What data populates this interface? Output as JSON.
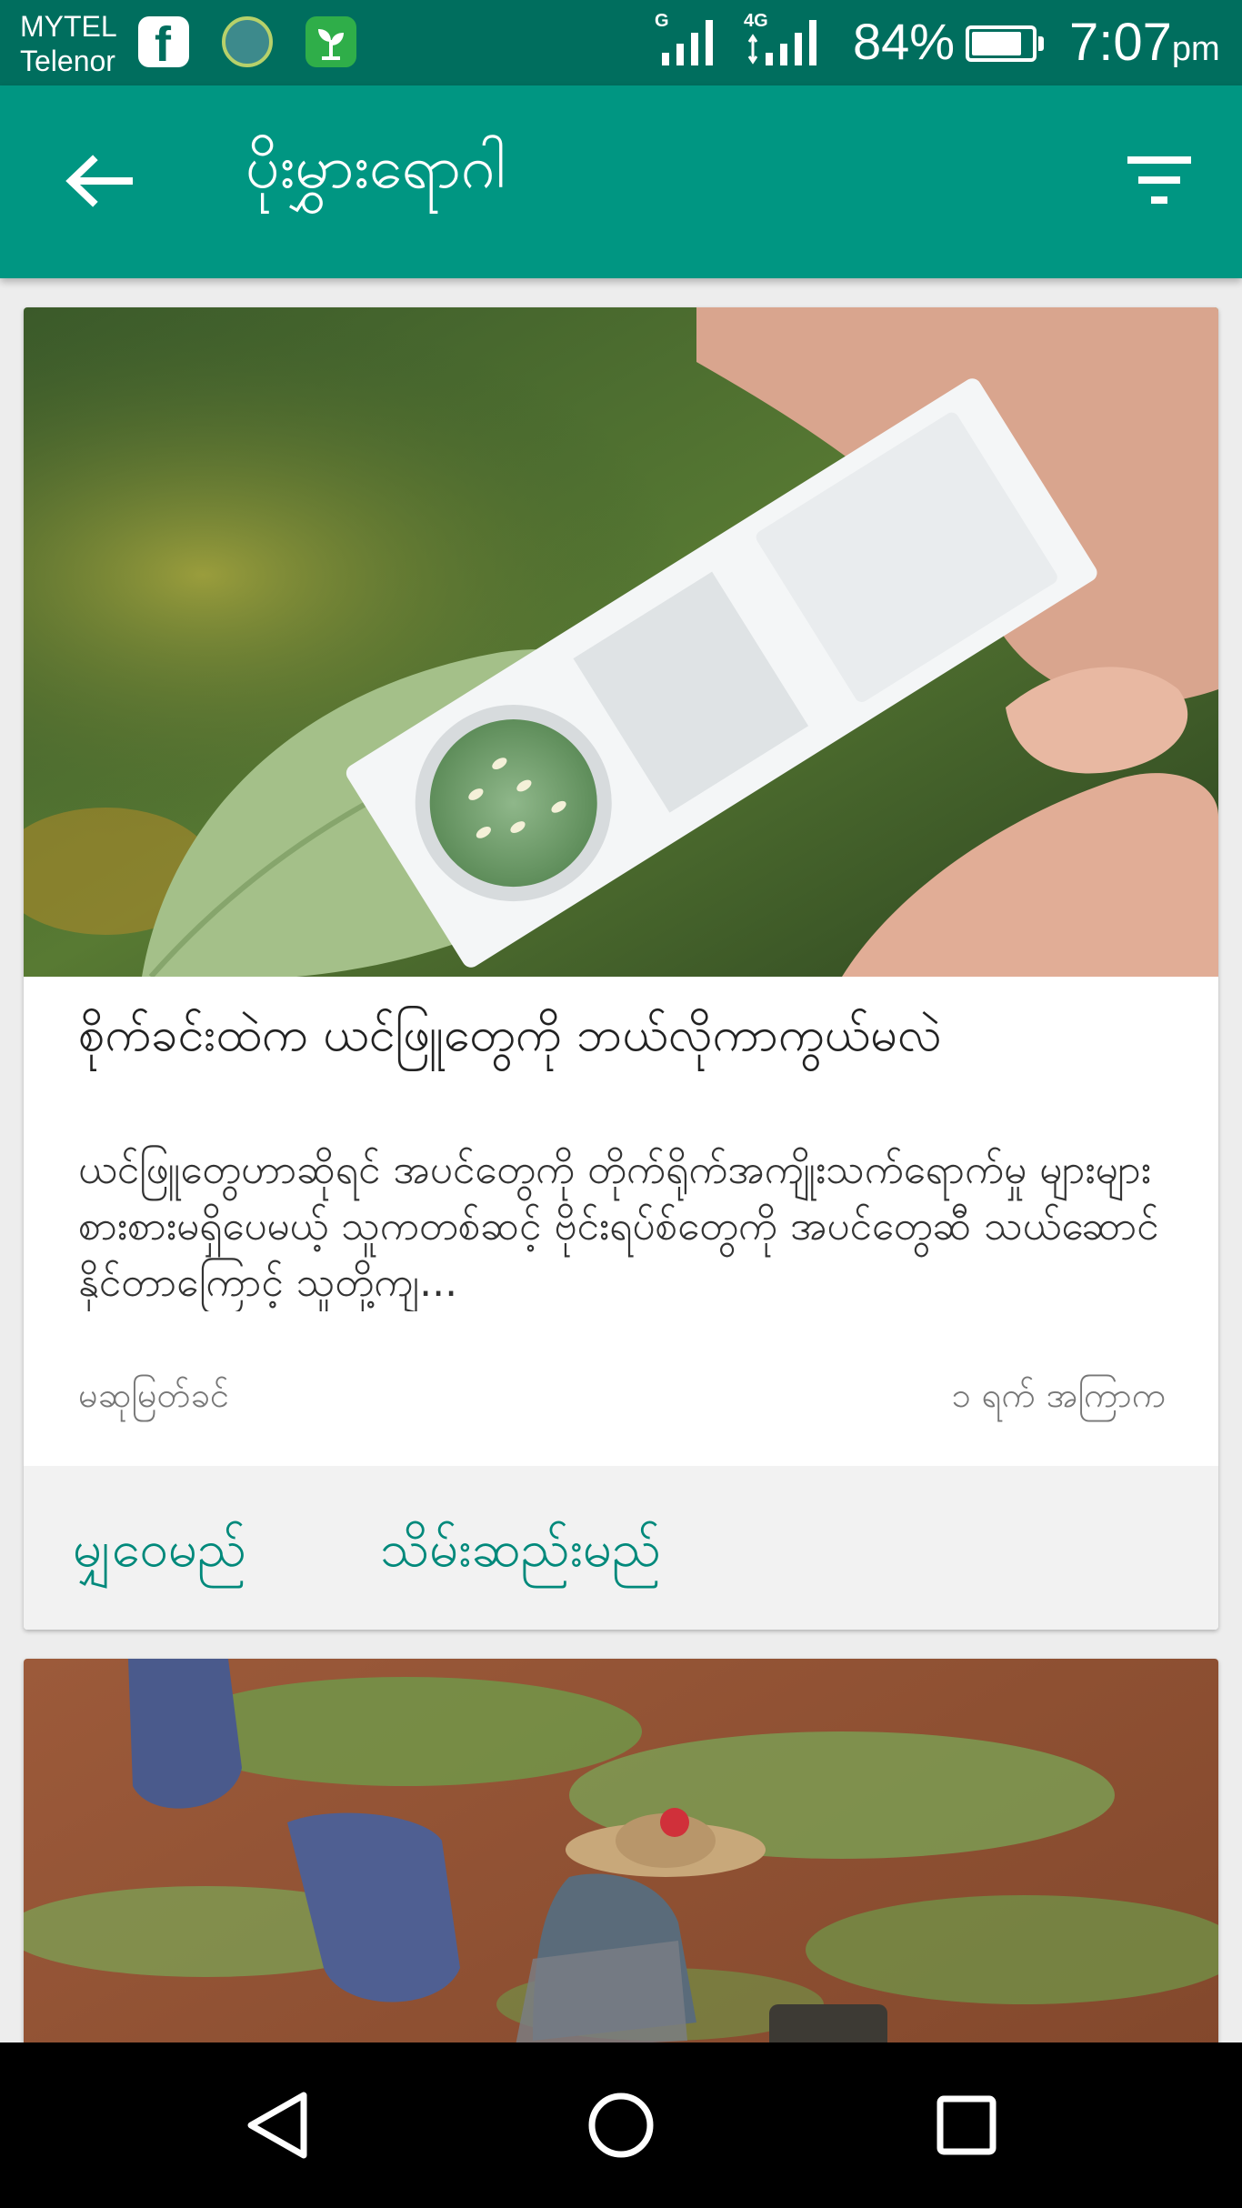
{
  "status_bar": {
    "carrier_line1": "MYTEL",
    "carrier_line2": "Telenor",
    "network1": "G",
    "network2": "4G",
    "battery_percent": "84%",
    "battery_level": 0.84,
    "time": "7:07",
    "time_suffix": "pm"
  },
  "app_bar": {
    "title": "ပိုးမွှားရောဂါ"
  },
  "articles": [
    {
      "title": "စိုက်ခင်းထဲက ယင်ဖြူတွေကို ဘယ်လိုကာကွယ်မလဲ",
      "summary": "ယင်ဖြူတွေဟာဆိုရင် အပင်တွေကို တိုက်ရိုက်အကျိုးသက်ရောက်မှု များများစားစားမရှိပေမယ့် သူကတစ်ဆင့် ဗိုင်းရပ်စ်တွေကို အပင်တွေဆီ သယ်ဆောင်နိုင်တာကြောင့် သူတို့ကျ...",
      "category": "မဆုမြတ်ခင်",
      "time_ago": "၁ ရက် အကြာက",
      "read_label": "မျှဝေမည်",
      "save_label": "သိမ်းဆည်းမည်"
    }
  ],
  "colors": {
    "status_bar": "#006e5e",
    "app_bar": "#009682",
    "accent": "#00897b"
  }
}
